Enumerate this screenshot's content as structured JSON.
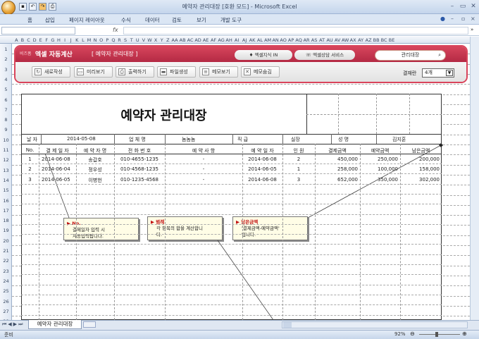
{
  "window": {
    "title": "예약자 관리대장  [호환 모드] - Microsoft Excel",
    "controls": [
      "–",
      "▭",
      "✕"
    ]
  },
  "ribbon": {
    "menus": [
      "홈",
      "삽입",
      "페이지 레이아웃",
      "수식",
      "데이터",
      "검토",
      "보기",
      "개발 도구"
    ]
  },
  "formula_bar": {
    "fx": "fx",
    "value": ""
  },
  "columns": [
    "A",
    "B",
    "C",
    "D",
    "E",
    "F",
    "G",
    "H",
    "I",
    "J",
    "K",
    "L",
    "M",
    "N",
    "O",
    "P",
    "Q",
    "R",
    "S",
    "T",
    "U",
    "V",
    "W",
    "X",
    "Y",
    "Z",
    "AA",
    "AB",
    "AC",
    "AD",
    "AE",
    "AF",
    "AG",
    "AH",
    "AI",
    "AJ",
    "AK",
    "AL",
    "AM",
    "AN",
    "AO",
    "AP",
    "AQ",
    "AR",
    "AS",
    "AT",
    "AU",
    "AV",
    "AW",
    "AX",
    "AY",
    "AZ",
    "BB",
    "BC",
    "BE"
  ],
  "rows": [
    "1",
    "2",
    "3",
    "4",
    "5",
    "6",
    "7",
    "8",
    "9",
    "10",
    "11",
    "12",
    "13",
    "14",
    "15",
    "16",
    "17",
    "18",
    "19",
    "20",
    "21",
    "22",
    "23",
    "24",
    "25",
    "26",
    "27",
    "28"
  ],
  "header": {
    "logo_small": "비즈폼",
    "logo": "엑셀 자동계산",
    "subtitle": "[ 예약자 관리대장 ]",
    "link1": "엑셀지식 IN",
    "link2": "엑셀상담 서비스",
    "search_value": "관리대장",
    "search_icon": "search-icon"
  },
  "toolbar": {
    "new": "새로작성",
    "preview": "미리보기",
    "print": "출력하기",
    "file": "파일생성",
    "memo_show": "메모보기",
    "memo_hide": "메모숨김",
    "count_label": "결재란",
    "count_value": "4개"
  },
  "doc": {
    "title": "예약자 관리대장",
    "info": {
      "date_label": "날 자",
      "date": "2014-05-08",
      "company_label": "업 체 명",
      "company": "놈놈놈",
      "rank_label": "직 급",
      "rank": "실장",
      "name_label": "성 명",
      "name": "김지훈"
    },
    "table_headers": [
      "No.",
      "결 제 일 자",
      "예 약 자 명",
      "전 화 번 호",
      "예 약 사 항",
      "예 약 일 자",
      "인 원",
      "결제금액",
      "예약금액",
      "남은금액"
    ],
    "table_rows": [
      [
        "1",
        "2014-06-08",
        "송갑호",
        "010-4655-1235",
        "-",
        "2014-06-08",
        "2",
        "450,000",
        "250,000",
        "200,000"
      ],
      [
        "2",
        "2014-06-04",
        "정우성",
        "010-4568-1235",
        "-",
        "2014-06-05",
        "1",
        "258,000",
        "100,000",
        "158,000"
      ],
      [
        "3",
        "2014-06-05",
        "이병헌",
        "010-1235-4568",
        "-",
        "2014-06-08",
        "3",
        "652,000",
        "350,000",
        "302,000"
      ]
    ]
  },
  "notes": [
    {
      "title": "No.",
      "body": "결제일자 입력 시\n자동입력됩니다."
    },
    {
      "title": "범례",
      "body": "각 항목의 합을 계산합니\n다."
    },
    {
      "title": "남은금액",
      "body": "'결제금액-예약금액'\n입니다."
    }
  ],
  "sheet_tabs": {
    "active": "예약자 관리대장"
  },
  "status": {
    "ready": "준비",
    "zoom": "92%"
  }
}
